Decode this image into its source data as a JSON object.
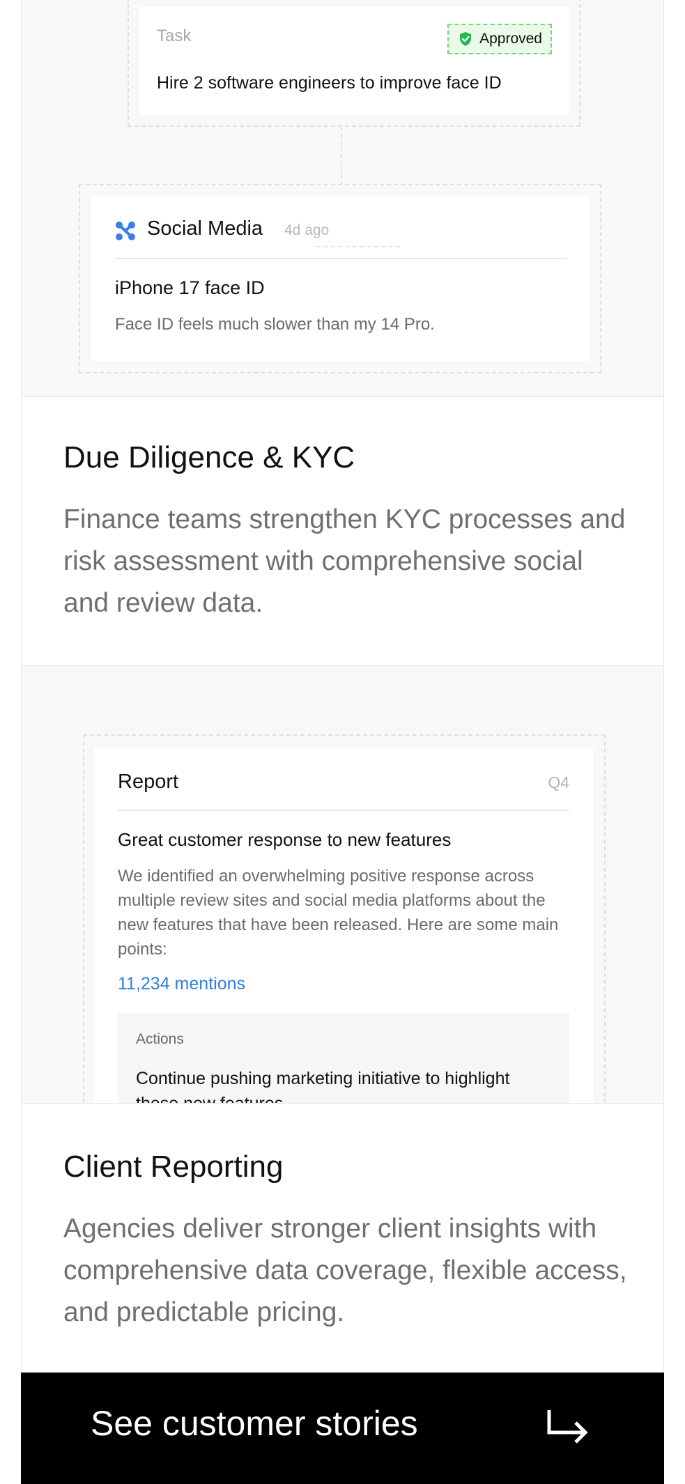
{
  "task_card": {
    "label": "Task",
    "status": "Approved",
    "text": "Hire 2 software engineers to improve face ID"
  },
  "social_card": {
    "source": "Social Media",
    "time": "4d ago",
    "heading": "iPhone 17 face ID",
    "body": "Face ID feels much slower than my 14 Pro."
  },
  "kyc": {
    "title": "Due Diligence & KYC",
    "description": "Finance teams strengthen KYC processes and risk assessment with comprehensive social and review data."
  },
  "report_card": {
    "title": "Report",
    "period": "Q4",
    "heading": "Great customer response to new features",
    "body": "We identified an overwhelming positive response across multiple review sites and social media platforms about the new features that have been released. Here are some main points:",
    "mentions": "11,234 mentions",
    "actions_label": "Actions",
    "actions_text": "Continue pushing marketing initiative to highlight these new features"
  },
  "client_reporting": {
    "title": "Client Reporting",
    "description": "Agencies deliver stronger client insights with comprehensive data coverage, flexible access, and predictable pricing."
  },
  "cta": {
    "label": "See customer stories"
  },
  "colors": {
    "approved_bg": "#eaf9ea",
    "approved_border": "#6fdc6f",
    "link_blue": "#2f7fe0",
    "cta_bg": "#000000"
  }
}
